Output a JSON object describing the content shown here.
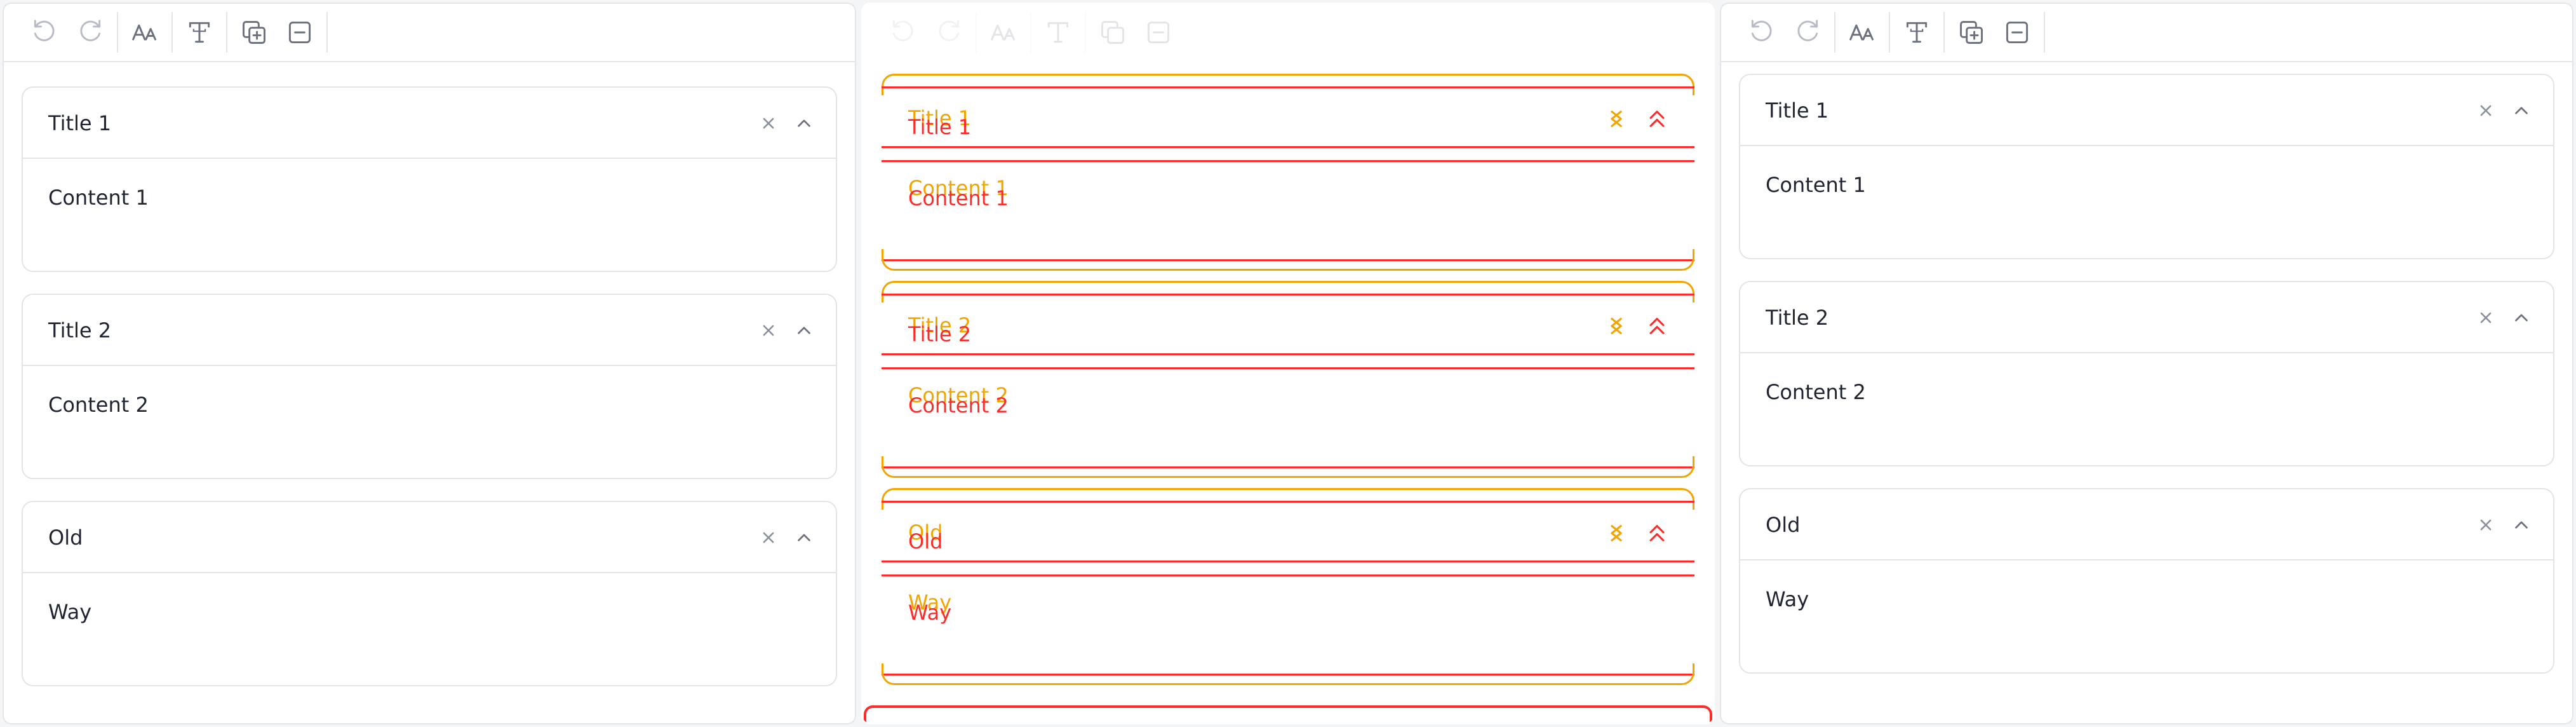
{
  "toolbar": {
    "icons": [
      "undo-icon",
      "redo-icon",
      "font-size-icon",
      "text-style-icon",
      "duplicate-icon",
      "remove-icon"
    ]
  },
  "accordions": [
    {
      "title": "Title 1",
      "content": "Content 1"
    },
    {
      "title": "Title 2",
      "content": "Content 2"
    },
    {
      "title": "Old",
      "content": "Way"
    }
  ],
  "accordion_icons": {
    "close": "close-icon",
    "collapse": "chevron-up-icon"
  },
  "colors": {
    "panel_bg": "#ffffff",
    "border": "#e4e6ea",
    "text": "#1f2430",
    "icon": "#8a909c",
    "debug_orange": "#f2a400",
    "debug_red": "#ff2b2b"
  }
}
